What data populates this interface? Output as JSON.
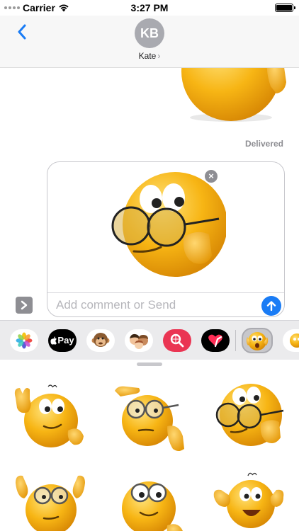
{
  "status_bar": {
    "carrier": "Carrier",
    "time": "3:27 PM"
  },
  "header": {
    "avatar_initials": "KB",
    "contact_name": "Kate",
    "chevron": "›"
  },
  "conversation": {
    "delivered_label": "Delivered"
  },
  "compose": {
    "placeholder": "Add comment or Send",
    "remove_symbol": "×"
  },
  "app_strip": {
    "apple_pay_label": "Pay",
    "apps": [
      "photos-icon",
      "apple-pay-icon",
      "monkey-animoji-icon",
      "memoji-icon",
      "image-search-icon",
      "digital-touch-icon",
      "emoji-sticker-app-icon"
    ]
  },
  "colors": {
    "accent": "#1a7cf5",
    "emoji_yellow": "#f7b514",
    "search_app": "#ea3553"
  }
}
